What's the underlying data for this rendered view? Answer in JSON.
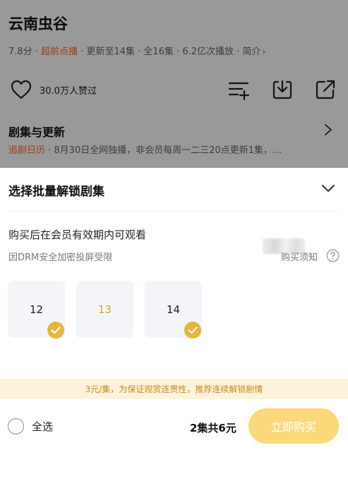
{
  "show": {
    "title": "云南虫谷",
    "rating": "7.8分 · ",
    "tag": "超前点播",
    "meta_rest": " · 更新至14集 · 全16集 · 6.2亿次播放 · 简介",
    "meta_chevron": "›",
    "likes": "30.0万人赞过",
    "episodes_title": "剧集与更新",
    "calendar_label": "追剧日历",
    "update_text": " · 8月30日全网独播，非会员每周一二三20点更新1集，…"
  },
  "sheet": {
    "title": "选择批量解锁剧集",
    "note": "购买后在会员有效期内可观看",
    "drm": "因DRM安全加密投屏受限",
    "notice_label": "购买须知",
    "episodes": [
      {
        "number": "12",
        "selected": true,
        "highlight": false
      },
      {
        "number": "13",
        "selected": false,
        "highlight": true
      },
      {
        "number": "14",
        "selected": true,
        "highlight": false
      }
    ],
    "promo": "3元/集，为保证观赏连贯性，推荐连续解锁剧情",
    "select_all_label": "全选",
    "summary": "2集共6元",
    "buy_label": "立即购买"
  },
  "colors": {
    "accent_orange": "#ff6a1a",
    "gold": "#e8b43a",
    "buy_button": "#fbd97a",
    "promo_bg": "#fdf2dc"
  }
}
